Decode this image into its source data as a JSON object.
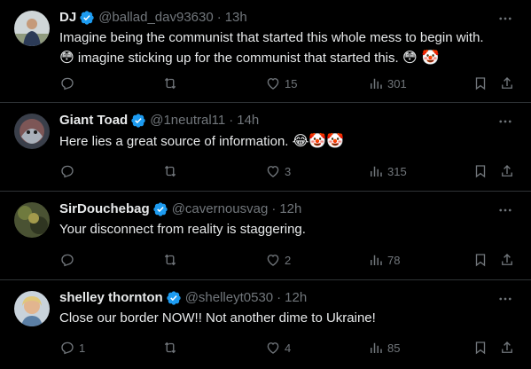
{
  "colors": {
    "background": "#000000",
    "text": "#e7e9ea",
    "muted": "#71767b",
    "verified": "#1d9bf0",
    "divider": "#2f3336"
  },
  "icons": {
    "verified": "verified-badge-icon",
    "more": "more-icon",
    "reply": "reply-icon",
    "retweet": "retweet-icon",
    "like": "heart-icon",
    "views": "views-icon",
    "bookmark": "bookmark-icon",
    "share": "share-icon"
  },
  "tweets": [
    {
      "name": "DJ",
      "handle": "@ballad_dav93630",
      "separator": "·",
      "time": "13h",
      "line1": "Imagine being the communist that started this whole mess to begin with.",
      "line2_emoji_before": "😳",
      "line2": " imagine sticking up for the communist that started this. ",
      "line2_emoji_after": "😳 🤡",
      "replies": "",
      "retweets": "",
      "likes": "15",
      "views": "301"
    },
    {
      "name": "Giant Toad",
      "handle": "@1neutral11",
      "separator": "·",
      "time": "14h",
      "line1": "Here lies a great source of information. ",
      "line1_emoji": "😂🤡🤡",
      "replies": "",
      "retweets": "",
      "likes": "3",
      "views": "315"
    },
    {
      "name": "SirDouchebag",
      "handle": "@cavernousvag",
      "separator": "·",
      "time": "12h",
      "line1": "Your disconnect from reality is staggering.",
      "replies": "",
      "retweets": "",
      "likes": "2",
      "views": "78"
    },
    {
      "name": "shelley thornton",
      "handle": "@shelleyt0530",
      "separator": "·",
      "time": "12h",
      "line1": "Close our border NOW!! Not another dime to Ukraine!",
      "replies": "1",
      "retweets": "",
      "likes": "4",
      "views": "85"
    }
  ]
}
